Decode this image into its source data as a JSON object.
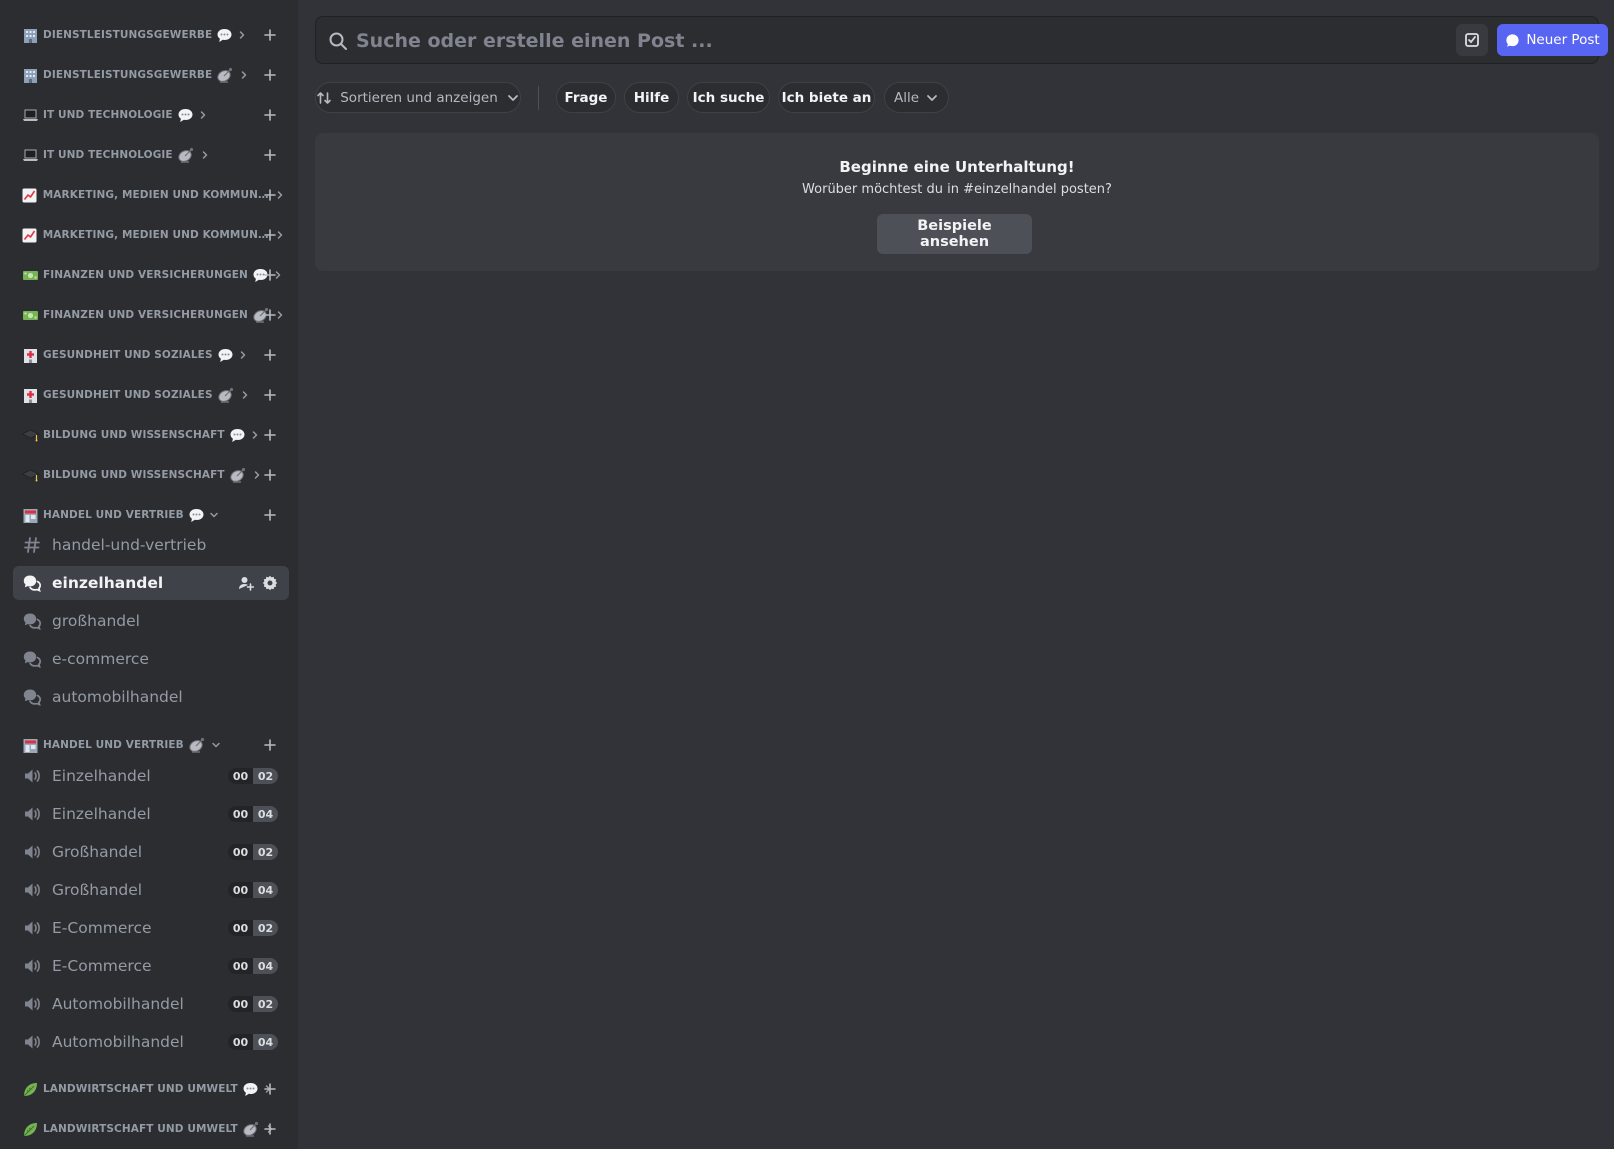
{
  "sidebar": {
    "categories": [
      {
        "name": "Dienstleistungsgewerbe",
        "emoji": "office-building-icon",
        "suffix": "speech-bubble-icon",
        "collapsed": true
      },
      {
        "name": "Dienstleistungsgewerbe",
        "emoji": "office-building-icon",
        "suffix": "satellite-icon",
        "collapsed": true
      },
      {
        "name": "IT und Technologie",
        "emoji": "laptop-icon",
        "suffix": "speech-bubble-icon",
        "collapsed": true
      },
      {
        "name": "IT und Technologie",
        "emoji": "laptop-icon",
        "suffix": "satellite-icon",
        "collapsed": true
      },
      {
        "name": "Marketing, Medien und Kommuni...",
        "emoji": "chart-up-icon",
        "suffix": "",
        "collapsed": true
      },
      {
        "name": "Marketing, Medien und Kommuni...",
        "emoji": "chart-up-icon",
        "suffix": "",
        "collapsed": true
      },
      {
        "name": "Finanzen und Versicherungen",
        "emoji": "money-icon",
        "suffix": "speech-bubble-icon",
        "collapsed": true
      },
      {
        "name": "Finanzen und Versicherungen",
        "emoji": "money-icon",
        "suffix": "satellite-icon",
        "collapsed": true
      },
      {
        "name": "Gesundheit und Soziales",
        "emoji": "hospital-icon",
        "suffix": "speech-bubble-icon",
        "collapsed": true
      },
      {
        "name": "Gesundheit und Soziales",
        "emoji": "hospital-icon",
        "suffix": "satellite-icon",
        "collapsed": true
      },
      {
        "name": "Bildung und Wissenschaft",
        "emoji": "graduation-cap-icon",
        "suffix": "speech-bubble-icon",
        "collapsed": true
      },
      {
        "name": "Bildung und Wissenschaft",
        "emoji": "graduation-cap-icon",
        "suffix": "satellite-icon",
        "collapsed": true
      },
      {
        "name": "Handel und Vertrieb",
        "emoji": "store-icon",
        "suffix": "speech-bubble-icon",
        "collapsed": false
      },
      {
        "name": "Handel und Vertrieb",
        "emoji": "store-icon",
        "suffix": "satellite-icon",
        "collapsed": false
      },
      {
        "name": "Landwirtschaft und Umwelt",
        "emoji": "leaf-icon",
        "suffix": "speech-bubble-icon",
        "collapsed": true
      },
      {
        "name": "Landwirtschaft und Umwelt",
        "emoji": "leaf-icon",
        "suffix": "satellite-icon",
        "collapsed": true
      }
    ],
    "text_channels": [
      {
        "name": "handel-und-vertrieb",
        "type": "text"
      },
      {
        "name": "einzelhandel",
        "type": "forum",
        "active": true
      },
      {
        "name": "großhandel",
        "type": "forum"
      },
      {
        "name": "e-commerce",
        "type": "forum"
      },
      {
        "name": "automobilhandel",
        "type": "forum"
      }
    ],
    "voice_channels": [
      {
        "name": "Einzelhandel",
        "count": "00",
        "limit": "02"
      },
      {
        "name": "Einzelhandel",
        "count": "00",
        "limit": "04"
      },
      {
        "name": "Großhandel",
        "count": "00",
        "limit": "02"
      },
      {
        "name": "Großhandel",
        "count": "00",
        "limit": "04"
      },
      {
        "name": "E-Commerce",
        "count": "00",
        "limit": "02"
      },
      {
        "name": "E-Commerce",
        "count": "00",
        "limit": "04"
      },
      {
        "name": "Automobilhandel",
        "count": "00",
        "limit": "02"
      },
      {
        "name": "Automobilhandel",
        "count": "00",
        "limit": "04"
      }
    ]
  },
  "main": {
    "search": {
      "placeholder": "Suche oder erstelle einen Post ..."
    },
    "new_post_label": "Neuer Post",
    "sort_label": "Sortieren und anzeigen",
    "tags": [
      "Frage",
      "Hilfe",
      "Ich suche",
      "Ich biete an"
    ],
    "tag_all_label": "Alle",
    "empty_state": {
      "title": "Beginne eine Unterhaltung!",
      "subtitle": "Worüber möchtest du in #einzelhandel posten?",
      "button_label": "Beispiele ansehen"
    }
  },
  "colors": {
    "accent": "#5865f2",
    "sidebar_bg": "#2b2d31",
    "main_bg": "#313338"
  }
}
